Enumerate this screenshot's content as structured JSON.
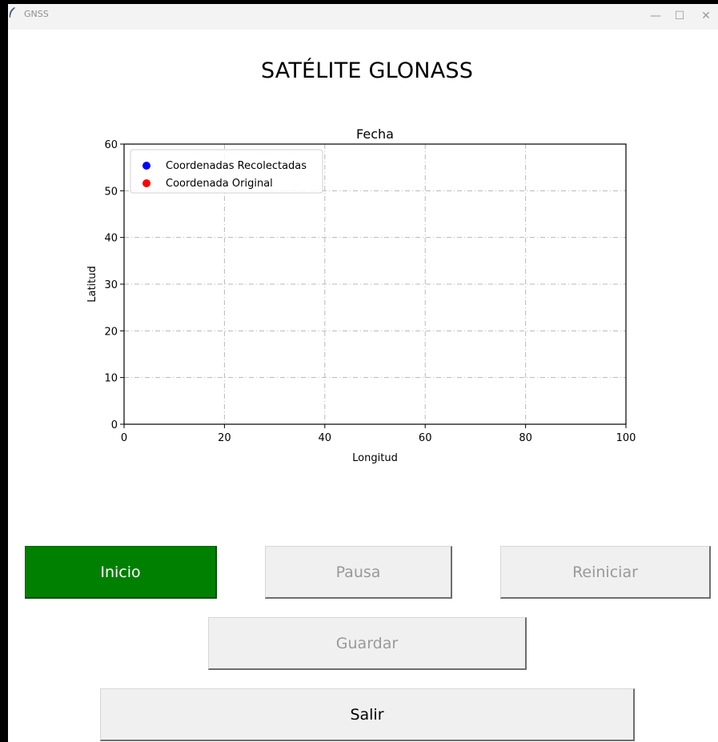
{
  "window": {
    "title": "GNSS",
    "controls": {
      "minimize": "—",
      "maximize": "☐",
      "close": "✕"
    }
  },
  "heading": "SATÉLITE GLONASS",
  "chart_data": {
    "type": "scatter",
    "title": "Fecha",
    "xlabel": "Longitud",
    "ylabel": "Latitud",
    "xlim": [
      0,
      100
    ],
    "ylim": [
      0,
      60
    ],
    "xticks": [
      0,
      20,
      40,
      60,
      80,
      100
    ],
    "yticks": [
      0,
      10,
      20,
      30,
      40,
      50,
      60
    ],
    "grid": true,
    "legend_position": "upper-left",
    "series": [
      {
        "name": "Coordenadas Recolectadas",
        "color": "#0000ff",
        "points": []
      },
      {
        "name": "Coordenada Original",
        "color": "#ff0000",
        "points": []
      }
    ]
  },
  "buttons": {
    "start": "Inicio",
    "pause": "Pausa",
    "restart": "Reiniciar",
    "save": "Guardar",
    "exit": "Salir"
  }
}
